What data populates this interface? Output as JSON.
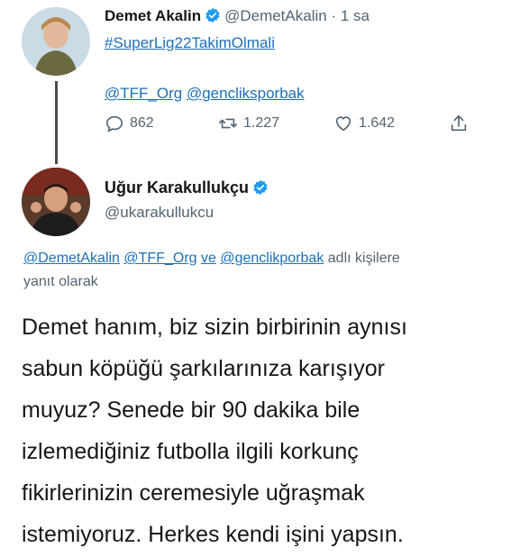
{
  "tweet1": {
    "name": "Demet Akalin",
    "handle": "@DemetAkalin",
    "dot": "·",
    "time": "1 sa",
    "hashtag": "#SuperLig22TakimOlmali",
    "mention_a": "@TFF_Org",
    "mention_b": "@gencliksporbak",
    "replies": "862",
    "retweets": "1.227",
    "likes": "1.642"
  },
  "tweet2": {
    "name": "Uğur Karakullukçu",
    "handle": "@ukarakullukcu",
    "reply_to_a": "@DemetAkalin",
    "reply_to_b": "@TFF_Org",
    "reply_to_ve": "ve",
    "reply_to_c": "@genclikporbak",
    "reply_suffix": "adlı kişilere",
    "reply_line2": "yanıt olarak",
    "body_lines": [
      "Demet hanım, biz sizin birbirinin aynısı",
      "sabun köpüğü şarkılarınıza karışıyor",
      "muyuz? Senede bir 90 dakika bile",
      "izlemediğiniz futbolla ilgili korkunç",
      "fikirlerinizin ceremesiyle uğraşmak",
      "istemiyoruz. Herkes kendi işini yapsın."
    ]
  },
  "colors": {
    "link": "#1d6fb8",
    "verified": "#1d9bf0",
    "muted": "#536471"
  },
  "icons": [
    "verified-badge-icon",
    "reply-icon",
    "retweet-icon",
    "like-icon",
    "share-icon"
  ]
}
